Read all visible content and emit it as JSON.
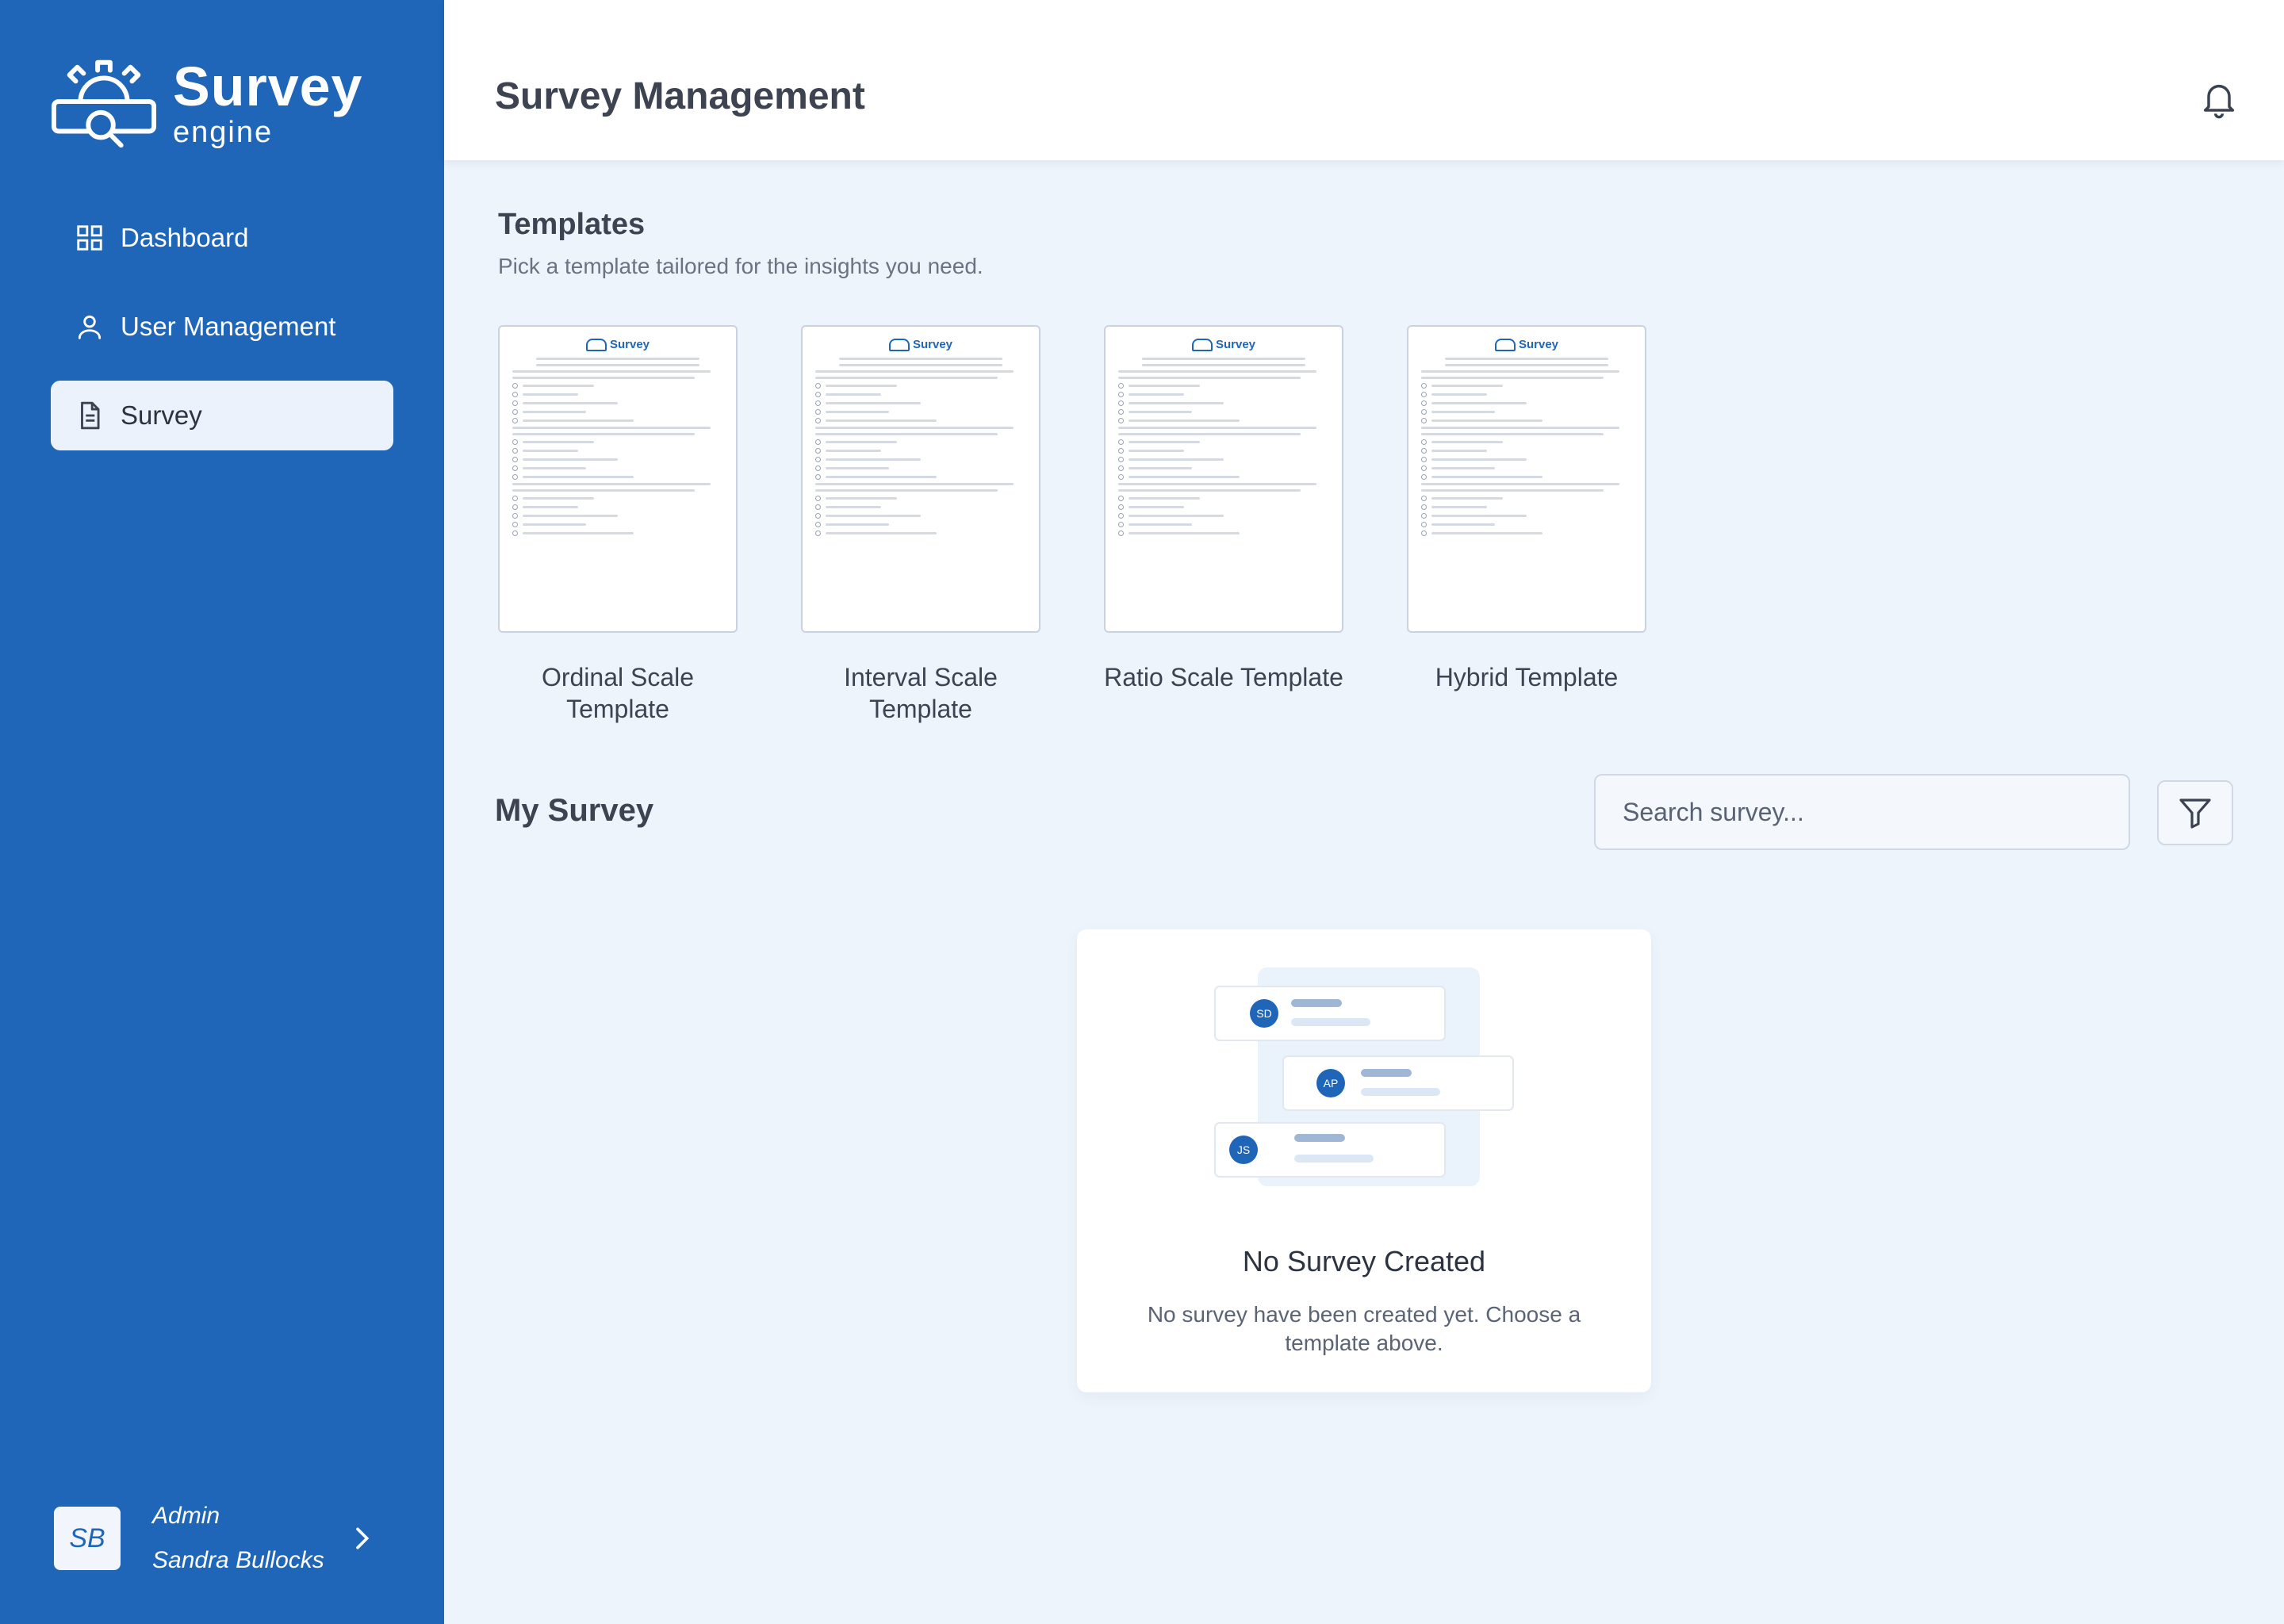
{
  "brand": {
    "title": "Survey",
    "subtitle": "engine"
  },
  "sidebar": {
    "items": [
      {
        "label": "Dashboard",
        "icon": "grid-icon"
      },
      {
        "label": "User Management",
        "icon": "user-icon"
      },
      {
        "label": "Survey",
        "icon": "document-icon",
        "active": true
      }
    ]
  },
  "profile": {
    "initials": "SB",
    "role": "Admin",
    "name": "Sandra Bullocks"
  },
  "header": {
    "title": "Survey Management"
  },
  "templates": {
    "title": "Templates",
    "subtitle": "Pick a template tailored for the insights you need.",
    "items": [
      {
        "label": "Ordinal Scale Template"
      },
      {
        "label": "Interval Scale Template"
      },
      {
        "label": "Ratio Scale Template"
      },
      {
        "label": "Hybrid Template"
      }
    ],
    "thumbnail_logo": "Survey"
  },
  "my_survey": {
    "title": "My Survey",
    "search_placeholder": "Search survey...",
    "empty": {
      "title": "No Survey Created",
      "description": "No survey have been created yet. Choose a template above.",
      "avatars": [
        "SD",
        "AP",
        "JS"
      ]
    }
  },
  "colors": {
    "primary": "#1f66b9",
    "background": "#eef4fc",
    "active_nav": "#ecf2fb"
  }
}
